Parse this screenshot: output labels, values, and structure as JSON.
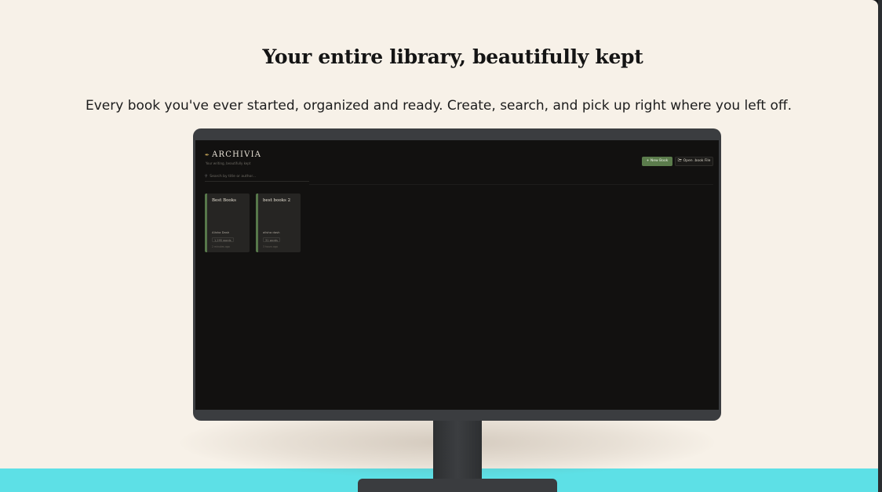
{
  "hero": {
    "title": "Your entire library, beautifully kept",
    "subtitle": "Every book you've ever started, organized and ready. Create, search, and pick up right where you left off."
  },
  "app": {
    "brand": "ARCHIVIA",
    "brand_icon": "quill-icon",
    "tagline": "Your writing, beautifully kept",
    "search_placeholder": "Search by title or author...",
    "new_book_label": "New Book",
    "open_file_label": "Open .book File",
    "books": [
      {
        "title": "Best Books",
        "author": "Alisha Dash",
        "words": "1,295 words",
        "updated": "2 minutes ago"
      },
      {
        "title": "best books 2",
        "author": "alisha dash",
        "words": "31 words",
        "updated": "3 hours ago"
      }
    ]
  },
  "colors": {
    "page_bg": "#f7f1e8",
    "screen_bg": "#121110",
    "accent_green": "#5b7c4c",
    "floor_cyan": "#5de0e6"
  }
}
